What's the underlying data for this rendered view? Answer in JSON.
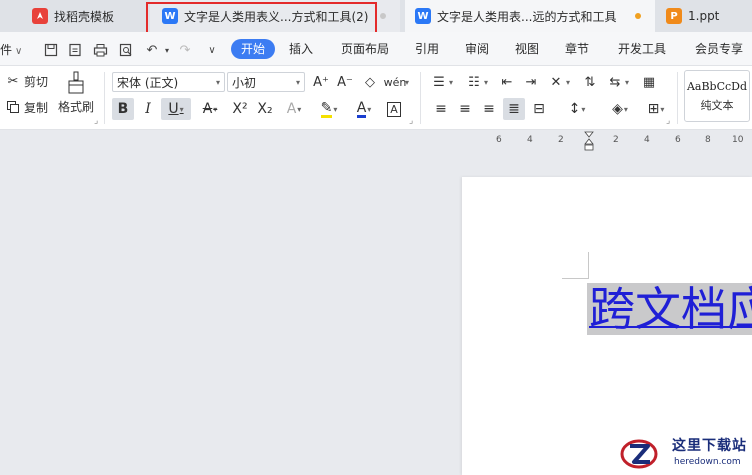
{
  "tabs": [
    {
      "label": "找稻壳模板",
      "icon": "daoke-icon"
    },
    {
      "label": "文字是人类用表义...方式和工具(2)",
      "icon": "wps-writer-icon"
    },
    {
      "label": "文字是人类用表...远的方式和工具",
      "icon": "wps-writer-icon"
    },
    {
      "label": "1.ppt",
      "icon": "wps-presentation-icon"
    }
  ],
  "tab_dot_colors": {
    "tab2": "#c8c8c8",
    "tab3": "#f0a020"
  },
  "menu": {
    "file_fragment": "件",
    "tabs": [
      "开始",
      "插入",
      "页面布局",
      "引用",
      "审阅",
      "视图",
      "章节",
      "开发工具",
      "会员专享"
    ],
    "active": "开始"
  },
  "ribbon": {
    "cut": "剪切",
    "copy": "复制",
    "format_painter": "格式刷",
    "font_name": "宋体 (正文)",
    "font_size": "小初",
    "style_sample": "AaBbCcDd",
    "style_name": "纯文本"
  },
  "ruler_ticks": [
    "6",
    "4",
    "2",
    "2",
    "4",
    "6",
    "8",
    "10"
  ],
  "document": {
    "selected_text": "跨文档应"
  },
  "watermark": {
    "title": "这里下载站",
    "url": "heredown.com"
  },
  "colors": {
    "accent": "#3c7cf2",
    "highlight_border": "#e32a2a",
    "doc_text": "#1f1fd6",
    "selection": "#c9c9cb"
  }
}
